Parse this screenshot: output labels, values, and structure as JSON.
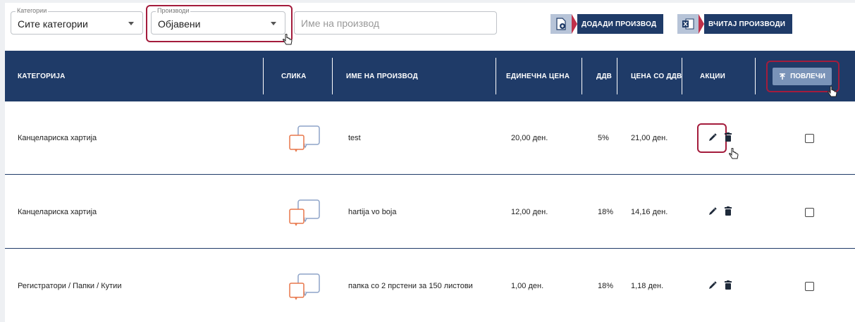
{
  "toolbar": {
    "category_legend": "Категории",
    "category_value": "Сите категории",
    "products_legend": "Производи",
    "products_value": "Објавени",
    "search_placeholder": "Име на производ",
    "add_product_label": "ДОДАДИ ПРОИЗВОД",
    "import_products_label": "ВЧИТАЈ ПРОИЗВОДИ"
  },
  "table": {
    "headers": {
      "category": "КАТЕГОРИЈА",
      "image": "СЛИКА",
      "name": "ИМЕ НА ПРОИЗВОД",
      "unit_price": "ЕДИНЕЧНА ЦЕНА",
      "vat": "ДДВ",
      "price_vat": "ЦЕНА СО ДДВ",
      "actions": "АКЦИИ",
      "pull": "ПОВЛЕЧИ"
    },
    "rows": [
      {
        "category": "Канцелариска хартија",
        "name": "test",
        "unit_price": "20,00 ден.",
        "vat": "5%",
        "price_vat": "21,00 ден."
      },
      {
        "category": "Канцелариска хартија",
        "name": "hartija vo boja",
        "unit_price": "12,00 ден.",
        "vat": "18%",
        "price_vat": "14,16 ден."
      },
      {
        "category": "Регистратори / Папки / Кутии",
        "name": "папка со 2 прстени за 150 листови",
        "unit_price": "1,00 ден.",
        "vat": "18%",
        "price_vat": "1,18 ден."
      }
    ]
  },
  "icons": {
    "edit": "pencil-icon",
    "delete": "trash-icon",
    "image_placeholder": "image-placeholder-icon",
    "add_product": "document-add-icon",
    "import_products": "excel-icon",
    "pull": "upload-icon"
  },
  "colors": {
    "header_bg": "#1f3b68",
    "highlight": "#a41c3c",
    "pull_button": "#7a93b8"
  }
}
